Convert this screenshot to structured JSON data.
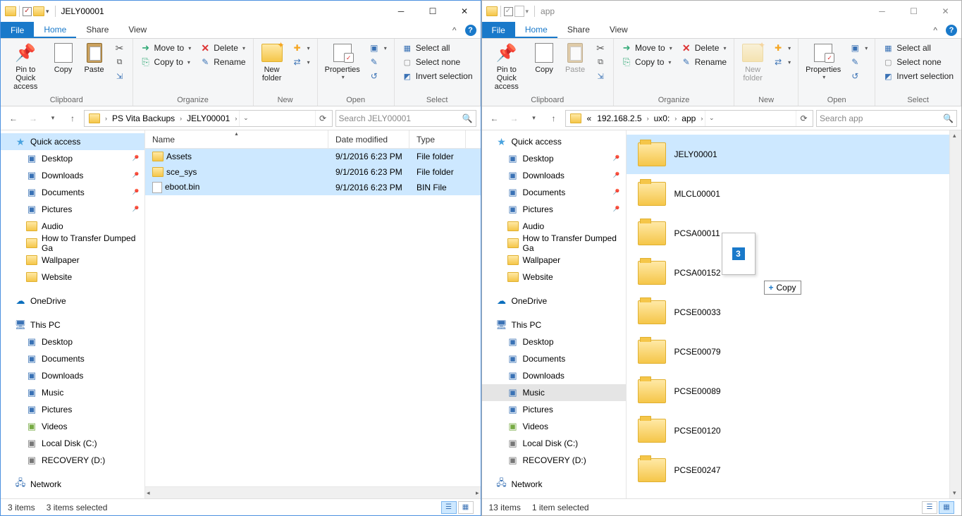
{
  "left": {
    "title": "JELY00001",
    "tabs": {
      "file": "File",
      "home": "Home",
      "share": "Share",
      "view": "View"
    },
    "ribbon": {
      "clipboard": {
        "pin": "Pin to Quick\naccess",
        "copy": "Copy",
        "paste": "Paste",
        "cut": "Cut",
        "copypath": "Copy path",
        "shortcut": "Paste shortcut",
        "label": "Clipboard"
      },
      "organize": {
        "moveto": "Move to",
        "copyto": "Copy to",
        "delete": "Delete",
        "rename": "Rename",
        "label": "Organize"
      },
      "new": {
        "newfolder": "New\nfolder",
        "newitem": "New item",
        "easy": "Easy access",
        "label": "New"
      },
      "open": {
        "properties": "Properties",
        "open": "Open",
        "edit": "Edit",
        "history": "History",
        "label": "Open"
      },
      "select": {
        "all": "Select all",
        "none": "Select none",
        "invert": "Invert selection",
        "label": "Select"
      }
    },
    "breadcrumb": [
      "PS Vita Backups",
      "JELY00001"
    ],
    "search_placeholder": "Search JELY00001",
    "columns": {
      "name": "Name",
      "date": "Date modified",
      "type": "Type"
    },
    "colwidths": {
      "name": 260,
      "date": 115,
      "type": 80
    },
    "files": [
      {
        "name": "Assets",
        "date": "9/1/2016 6:23 PM",
        "type": "File folder",
        "kind": "folder",
        "sel": true
      },
      {
        "name": "sce_sys",
        "date": "9/1/2016 6:23 PM",
        "type": "File folder",
        "kind": "folder",
        "sel": true
      },
      {
        "name": "eboot.bin",
        "date": "9/1/2016 6:23 PM",
        "type": "BIN File",
        "kind": "file",
        "sel": true
      }
    ],
    "nav": {
      "quick": "Quick access",
      "pinned": [
        {
          "label": "Desktop",
          "icon": "i-desktop"
        },
        {
          "label": "Downloads",
          "icon": "i-downloads"
        },
        {
          "label": "Documents",
          "icon": "i-docs"
        },
        {
          "label": "Pictures",
          "icon": "i-pics"
        }
      ],
      "recent": [
        {
          "label": "Audio"
        },
        {
          "label": "How to Transfer Dumped Ga"
        },
        {
          "label": "Wallpaper"
        },
        {
          "label": "Website"
        }
      ],
      "onedrive": "OneDrive",
      "thispc": "This PC",
      "pcitems": [
        {
          "label": "Desktop",
          "icon": "i-desktop"
        },
        {
          "label": "Documents",
          "icon": "i-docs"
        },
        {
          "label": "Downloads",
          "icon": "i-downloads"
        },
        {
          "label": "Music",
          "icon": "i-music"
        },
        {
          "label": "Pictures",
          "icon": "i-pics"
        },
        {
          "label": "Videos",
          "icon": "i-videos"
        },
        {
          "label": "Local Disk (C:)",
          "icon": "i-disk"
        },
        {
          "label": "RECOVERY (D:)",
          "icon": "i-disk"
        }
      ],
      "network": "Network"
    },
    "status": {
      "items": "3 items",
      "selected": "3 items selected"
    }
  },
  "right": {
    "title": "app",
    "tabs": {
      "file": "File",
      "home": "Home",
      "share": "Share",
      "view": "View"
    },
    "breadcrumb_prefix": "«",
    "breadcrumb": [
      "192.168.2.5",
      "ux0:",
      "app"
    ],
    "search_placeholder": "Search app",
    "folders": [
      {
        "name": "JELY00001",
        "sel": true
      },
      {
        "name": "MLCL00001"
      },
      {
        "name": "PCSA00011"
      },
      {
        "name": "PCSA00152"
      },
      {
        "name": "PCSE00033"
      },
      {
        "name": "PCSE00079"
      },
      {
        "name": "PCSE00089"
      },
      {
        "name": "PCSE00120"
      },
      {
        "name": "PCSE00247"
      }
    ],
    "nav": {
      "quick": "Quick access",
      "pinned": [
        {
          "label": "Desktop",
          "icon": "i-desktop"
        },
        {
          "label": "Downloads",
          "icon": "i-downloads"
        },
        {
          "label": "Documents",
          "icon": "i-docs"
        },
        {
          "label": "Pictures",
          "icon": "i-pics"
        }
      ],
      "recent": [
        {
          "label": "Audio"
        },
        {
          "label": "How to Transfer Dumped Ga"
        },
        {
          "label": "Wallpaper"
        },
        {
          "label": "Website"
        }
      ],
      "onedrive": "OneDrive",
      "thispc": "This PC",
      "pcitems": [
        {
          "label": "Desktop",
          "icon": "i-desktop"
        },
        {
          "label": "Documents",
          "icon": "i-docs"
        },
        {
          "label": "Downloads",
          "icon": "i-downloads"
        },
        {
          "label": "Music",
          "icon": "i-music",
          "hov": true
        },
        {
          "label": "Pictures",
          "icon": "i-pics"
        },
        {
          "label": "Videos",
          "icon": "i-videos"
        },
        {
          "label": "Local Disk (C:)",
          "icon": "i-disk"
        },
        {
          "label": "RECOVERY (D:)",
          "icon": "i-disk"
        }
      ],
      "network": "Network"
    },
    "status": {
      "items": "13 items",
      "selected": "1 item selected"
    },
    "drag": {
      "count": "3",
      "tooltip": "Copy"
    }
  }
}
